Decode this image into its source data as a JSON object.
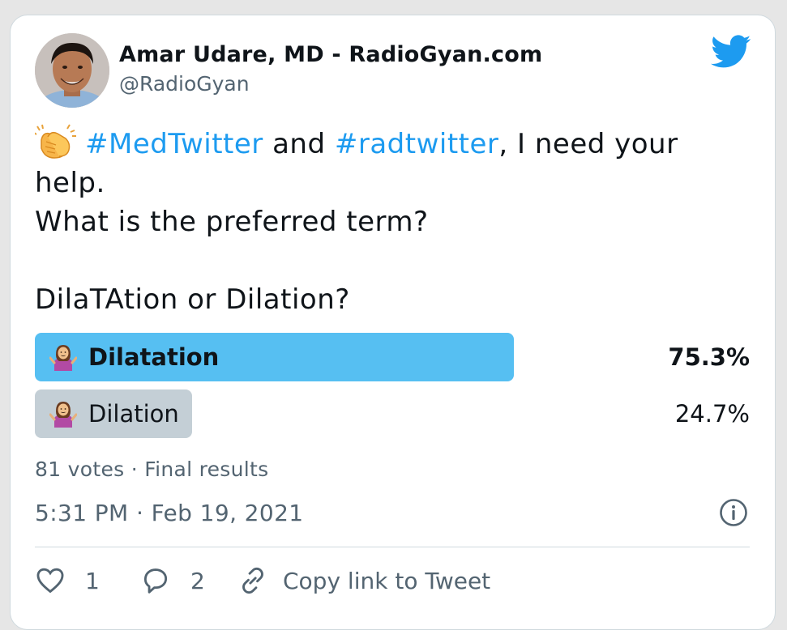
{
  "author": {
    "name": "Amar Udare, MD - RadioGyan.com",
    "handle": "@RadioGyan"
  },
  "tweet": {
    "emoji_icon": "clapping-hands-icon",
    "hashtag1": "#MedTwitter",
    "and": "and",
    "hashtag2": "#radtwitter",
    "rest_line1": ", I need your",
    "line2": "help.",
    "line3": "What is the preferred term?",
    "line5": "DilaTAtion or Dilation?"
  },
  "poll": {
    "options": [
      {
        "label": "Dilatation",
        "percent_text": "75.3%",
        "fraction": 0.753,
        "winner": true,
        "icon": "person-shrugging-icon"
      },
      {
        "label": "Dilation",
        "percent_text": "24.7%",
        "fraction": 0.247,
        "winner": false,
        "icon": "person-shrugging-icon"
      }
    ],
    "votes": "81 votes",
    "separator": "·",
    "status": "Final results"
  },
  "timestamp": {
    "time": "5:31 PM",
    "separator": "·",
    "date": "Feb 19, 2021"
  },
  "actions": {
    "likes": "1",
    "replies": "2",
    "copy_link": "Copy link to Tweet"
  },
  "colors": {
    "accent": "#1d9bf0",
    "winner_bar": "#56bff2",
    "loser_bar": "#c4cfd6",
    "muted_text": "#536471",
    "twitter_blue": "#1d9bf0"
  }
}
